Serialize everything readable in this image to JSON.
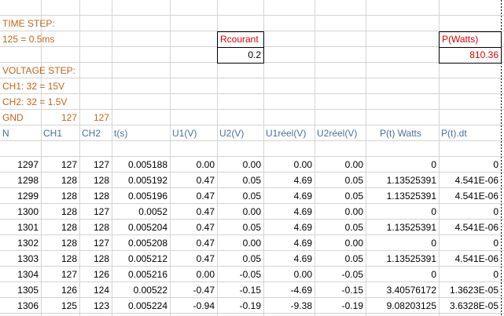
{
  "info": {
    "time_step_label": "TIME STEP:",
    "time_step_value": "125 = 0.5ms",
    "voltage_step_label": "VOLTAGE STEP:",
    "ch1_step": "CH1:  32 = 15V",
    "ch2_step": "CH2:  32 = 1.5V",
    "gnd_label": "GND",
    "gnd_ch1": "127",
    "gnd_ch2": "127"
  },
  "rcourant": {
    "label": "Rcourant",
    "value": "0.2"
  },
  "power": {
    "label": "P(Watts)",
    "value": "810.36"
  },
  "headers": [
    "N",
    "CH1",
    "CH2",
    "t(s)",
    "U1(V)",
    "U2(V)",
    "U1réel(V)",
    "U2réel(V)",
    "P(t) Watts",
    "P(t).dt"
  ],
  "rows": [
    [
      "1297",
      "127",
      "127",
      "0.005188",
      "0.00",
      "0.00",
      "0.00",
      "0.00",
      "0",
      "0"
    ],
    [
      "1298",
      "128",
      "128",
      "0.005192",
      "0.47",
      "0.05",
      "4.69",
      "0.05",
      "1.13525391",
      "4.541E-06"
    ],
    [
      "1299",
      "128",
      "128",
      "0.005196",
      "0.47",
      "0.05",
      "4.69",
      "0.05",
      "1.13525391",
      "4.541E-06"
    ],
    [
      "1300",
      "128",
      "127",
      "0.0052",
      "0.47",
      "0.00",
      "4.69",
      "0.00",
      "0",
      "0"
    ],
    [
      "1301",
      "128",
      "128",
      "0.005204",
      "0.47",
      "0.05",
      "4.69",
      "0.05",
      "1.13525391",
      "4.541E-06"
    ],
    [
      "1302",
      "128",
      "127",
      "0.005208",
      "0.47",
      "0.00",
      "4.69",
      "0.00",
      "0",
      "0"
    ],
    [
      "1303",
      "128",
      "128",
      "0.005212",
      "0.47",
      "0.05",
      "4.69",
      "0.05",
      "1.13525391",
      "4.541E-06"
    ],
    [
      "1304",
      "127",
      "126",
      "0.005216",
      "0.00",
      "-0.05",
      "0.00",
      "-0.05",
      "0",
      "0"
    ],
    [
      "1305",
      "126",
      "124",
      "0.00522",
      "-0.47",
      "-0.15",
      "-4.69",
      "-0.15",
      "3.40576172",
      "1.3623E-05"
    ],
    [
      "1306",
      "125",
      "123",
      "0.005224",
      "-0.94",
      "-0.19",
      "-9.38",
      "-0.19",
      "9.08203125",
      "3.6328E-05"
    ]
  ],
  "colors": {
    "label_orange": "#c0651d",
    "header_blue": "#4f6f99",
    "value_red": "#e00000",
    "grid": "#d4d4d4"
  }
}
